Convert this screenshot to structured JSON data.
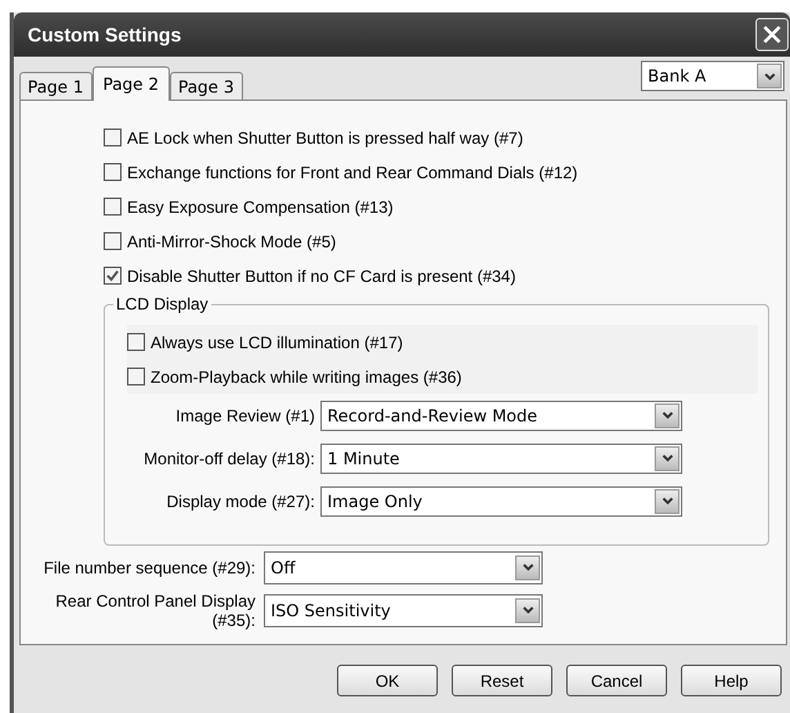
{
  "window": {
    "title": "Custom Settings"
  },
  "tabs": [
    {
      "label": "Page 1",
      "selected": false
    },
    {
      "label": "Page 2",
      "selected": true
    },
    {
      "label": "Page 3",
      "selected": false
    }
  ],
  "bank": {
    "value": "Bank A"
  },
  "options": [
    {
      "label": "AE Lock when Shutter Button is pressed half way (#7)",
      "checked": false
    },
    {
      "label": "Exchange functions for Front and Rear Command Dials (#12)",
      "checked": false
    },
    {
      "label": "Easy Exposure Compensation (#13)",
      "checked": false
    },
    {
      "label": "Anti-Mirror-Shock Mode (#5)",
      "checked": false
    },
    {
      "label": "Disable Shutter Button if no CF Card is present (#34)",
      "checked": true
    }
  ],
  "lcd_display": {
    "title": "LCD Display",
    "options": [
      {
        "label": "Always use LCD illumination (#17)",
        "checked": false
      },
      {
        "label": "Zoom-Playback while writing images (#36)",
        "checked": false
      }
    ],
    "selects": [
      {
        "label": "Image Review (#1)",
        "value": "Record-and-Review Mode"
      },
      {
        "label": "Monitor-off delay (#18):",
        "value": "1 Minute"
      },
      {
        "label": "Display mode (#27):",
        "value": "Image Only"
      }
    ]
  },
  "selects": [
    {
      "label": "File number sequence (#29):",
      "value": "Off"
    },
    {
      "label": "Rear Control Panel Display (#35):",
      "value": "ISO Sensitivity"
    }
  ],
  "buttons": [
    "OK",
    "Reset",
    "Cancel",
    "Help"
  ]
}
